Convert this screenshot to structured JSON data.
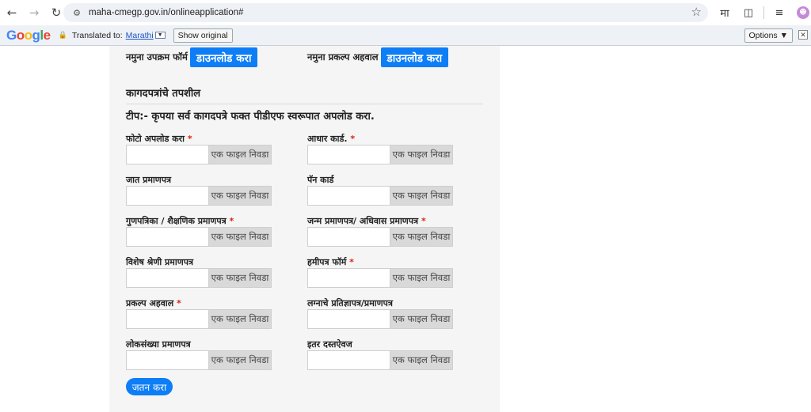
{
  "browser": {
    "url": "maha-cmegp.gov.in/onlineapplication#",
    "profile_letter": "मा"
  },
  "translate_bar": {
    "logo_letters": [
      "G",
      "o",
      "o",
      "g",
      "l",
      "e"
    ],
    "translated_to": "Translated to:",
    "language": "Marathi",
    "show_original": "Show original",
    "options": "Options ▼"
  },
  "samples": {
    "enterprise_form_label": "नमुना उपक्रम फॉर्म",
    "enterprise_form_button": "डाउनलोड करा",
    "project_report_label": "नमुना प्रकल्प अहवाल",
    "project_report_button": "डाउनलोड करा"
  },
  "section": {
    "title": "कागदपत्रांचे तपशील",
    "note": "टीप:- कृपया सर्व कागदपत्रे फक्त पीडीएफ स्वरूपात अपलोड करा."
  },
  "file_button_label": "एक फाइल निवडा",
  "fields": [
    {
      "label": "फोटो अपलोड करा",
      "required": true
    },
    {
      "label": "आधार कार्ड.",
      "required": true
    },
    {
      "label": "जात प्रमाणपत्र",
      "required": false
    },
    {
      "label": "पॅन कार्ड",
      "required": false
    },
    {
      "label": "गुणपत्रिका / शैक्षणिक प्रमाणपत्र",
      "required": true
    },
    {
      "label": "जन्म प्रमाणपत्र/ अधिवास प्रमाणपत्र",
      "required": true
    },
    {
      "label": "विशेष श्रेणी प्रमाणपत्र",
      "required": false
    },
    {
      "label": "हमीपत्र फॉर्म",
      "required": true
    },
    {
      "label": "प्रकल्प अहवाल",
      "required": true
    },
    {
      "label": "लग्नाचे प्रतिज्ञापत्र/प्रमाणपत्र",
      "required": false
    },
    {
      "label": "लोकसंख्या प्रमाणपत्र",
      "required": false
    },
    {
      "label": "इतर दस्तऐवज",
      "required": false
    }
  ],
  "required_marker": "*",
  "save_button": "जतन करा",
  "colors": {
    "accent": "#0d7ef6",
    "required": "#dd2211"
  }
}
